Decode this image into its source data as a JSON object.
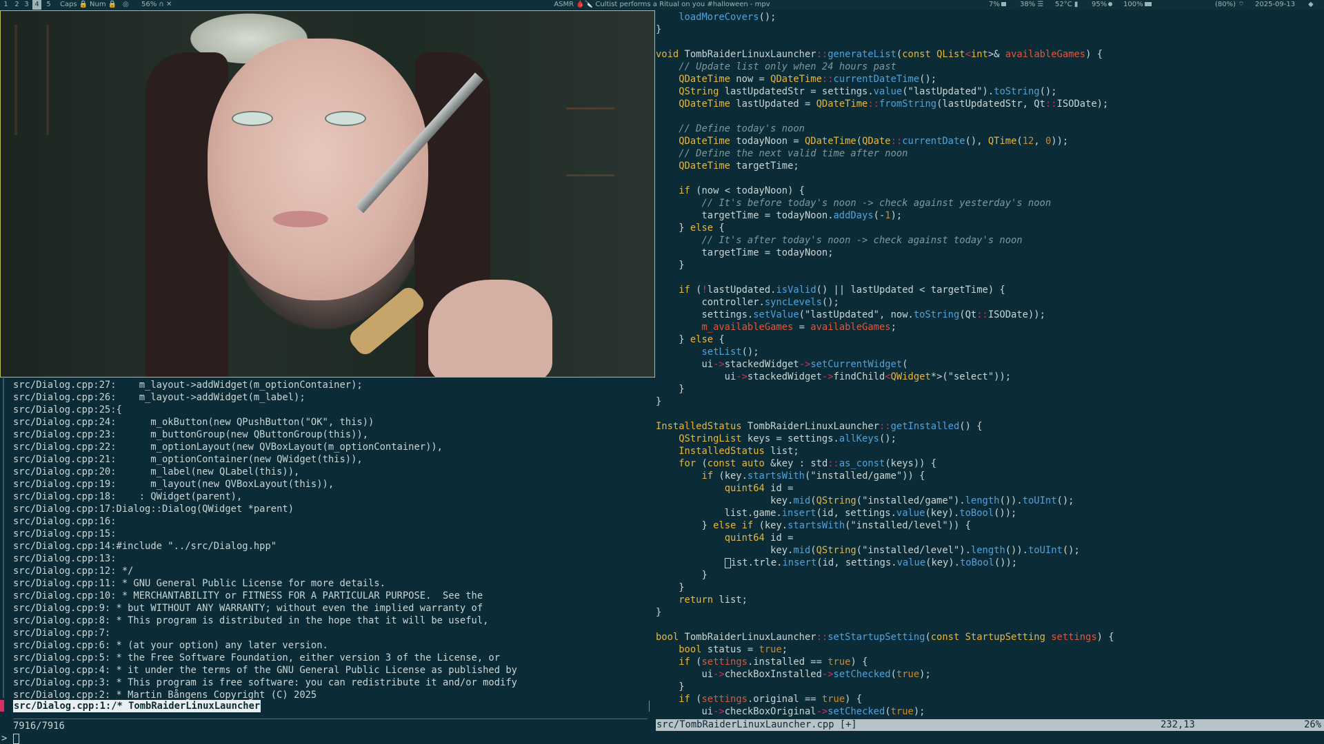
{
  "topbar": {
    "workspaces": [
      "1",
      "2",
      "3",
      "4",
      "5"
    ],
    "active_workspace": "4",
    "caps": "Caps",
    "num": "Num",
    "volume": "56%",
    "title": "ASMR 🩸🔪 Cultist performs a Ritual on you #halloween - mpv",
    "cpu": "7%",
    "mem": "38%",
    "temp": "52°C",
    "disk": "95%",
    "battery": "100%",
    "wifi": "(80%)",
    "date": "2025-09-13"
  },
  "terminal": {
    "lines": [
      "src/Dialog.cpp:27:    m_layout->addWidget(m_optionContainer);",
      "src/Dialog.cpp:26:    m_layout->addWidget(m_label);",
      "src/Dialog.cpp:25:{",
      "src/Dialog.cpp:24:      m_okButton(new QPushButton(\"OK\", this))",
      "src/Dialog.cpp:23:      m_buttonGroup(new QButtonGroup(this)),",
      "src/Dialog.cpp:22:      m_optionLayout(new QVBoxLayout(m_optionContainer)),",
      "src/Dialog.cpp:21:      m_optionContainer(new QWidget(this)),",
      "src/Dialog.cpp:20:      m_label(new QLabel(this)),",
      "src/Dialog.cpp:19:      m_layout(new QVBoxLayout(this)),",
      "src/Dialog.cpp:18:    : QWidget(parent),",
      "src/Dialog.cpp:17:Dialog::Dialog(QWidget *parent)",
      "src/Dialog.cpp:16:",
      "src/Dialog.cpp:15:",
      "src/Dialog.cpp:14:#include \"../src/Dialog.hpp\"",
      "src/Dialog.cpp:13:",
      "src/Dialog.cpp:12: */",
      "src/Dialog.cpp:11: * GNU General Public License for more details.",
      "src/Dialog.cpp:10: * MERCHANTABILITY or FITNESS FOR A PARTICULAR PURPOSE.  See the",
      "src/Dialog.cpp:9: * but WITHOUT ANY WARRANTY; without even the implied warranty of",
      "src/Dialog.cpp:8: * This program is distributed in the hope that it will be useful,",
      "src/Dialog.cpp:7:",
      "src/Dialog.cpp:6: * (at your option) any later version.",
      "src/Dialog.cpp:5: * the Free Software Foundation, either version 3 of the License, or",
      "src/Dialog.cpp:4: * it under the terms of the GNU General Public License as published by",
      "src/Dialog.cpp:3: * This program is free software: you can redistribute it and/or modify",
      "src/Dialog.cpp:2: * Martin Bångens Copyright (C) 2025"
    ],
    "selected_line": "src/Dialog.cpp:1:/* TombRaiderLinuxLauncher",
    "match_count": "7916/7916",
    "prompt": ">"
  },
  "editor": {
    "filename": "src/TombRaiderLinuxLauncher.cpp [+]",
    "position": "232,13",
    "percent": "26%",
    "code": [
      "    loadMoreCovers();",
      "}",
      "",
      "void TombRaiderLinuxLauncher::generateList(const QList<int>& availableGames) {",
      "    // Update list only when 24 hours past",
      "    QDateTime now = QDateTime::currentDateTime();",
      "    QString lastUpdatedStr = settings.value(\"lastUpdated\").toString();",
      "    QDateTime lastUpdated = QDateTime::fromString(lastUpdatedStr, Qt::ISODate);",
      "",
      "    // Define today's noon",
      "    QDateTime todayNoon = QDateTime(QDate::currentDate(), QTime(12, 0));",
      "    // Define the next valid time after noon",
      "    QDateTime targetTime;",
      "",
      "    if (now < todayNoon) {",
      "        // It's before today's noon -> check against yesterday's noon",
      "        targetTime = todayNoon.addDays(-1);",
      "    } else {",
      "        // It's after today's noon -> check against today's noon",
      "        targetTime = todayNoon;",
      "    }",
      "",
      "    if (!lastUpdated.isValid() || lastUpdated < targetTime) {",
      "        controller.syncLevels();",
      "        settings.setValue(\"lastUpdated\", now.toString(Qt::ISODate));",
      "        m_availableGames = availableGames;",
      "    } else {",
      "        setList();",
      "        ui->stackedWidget->setCurrentWidget(",
      "            ui->stackedWidget->findChild<QWidget*>(\"select\"));",
      "    }",
      "}",
      "",
      "InstalledStatus TombRaiderLinuxLauncher::getInstalled() {",
      "    QStringList keys = settings.allKeys();",
      "    InstalledStatus list;",
      "    for (const auto &key : std::as_const(keys)) {",
      "        if (key.startsWith(\"installed/game\")) {",
      "            quint64 id =",
      "                    key.mid(QString(\"installed/game\").length()).toUInt();",
      "            list.game.insert(id, settings.value(key).toBool());",
      "        } else if (key.startsWith(\"installed/level\")) {",
      "            quint64 id =",
      "                    key.mid(QString(\"installed/level\").length()).toUInt();",
      "            list.trle.insert(id, settings.value(key).toBool());",
      "        }",
      "    }",
      "    return list;",
      "}",
      "",
      "bool TombRaiderLinuxLauncher::setStartupSetting(const StartupSetting settings) {",
      "    bool status = true;",
      "    if (settings.installed == true) {",
      "        ui->checkBoxInstalled->setChecked(true);",
      "    }",
      "    if (settings.original == true) {",
      "        ui->checkBoxOriginal->setChecked(true);"
    ]
  }
}
